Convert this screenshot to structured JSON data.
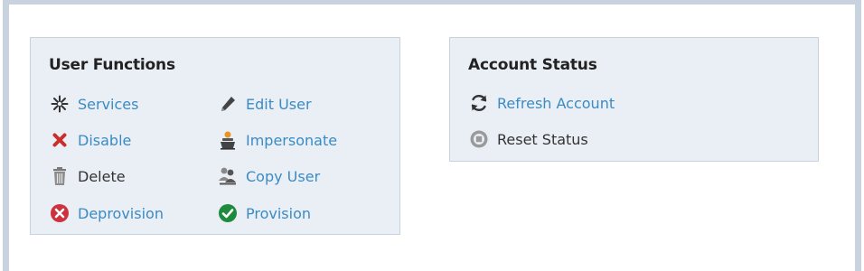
{
  "user_functions": {
    "title": "User Functions",
    "items": [
      {
        "label": "Services",
        "icon": "asterisk-icon",
        "link": true
      },
      {
        "label": "Edit User",
        "icon": "pencil-icon",
        "link": true
      },
      {
        "label": "Disable",
        "icon": "red-x-icon",
        "link": true
      },
      {
        "label": "Impersonate",
        "icon": "impersonate-icon",
        "link": true
      },
      {
        "label": "Delete",
        "icon": "trash-icon",
        "link": false
      },
      {
        "label": "Copy User",
        "icon": "copy-user-icon",
        "link": true
      },
      {
        "label": "Deprovision",
        "icon": "red-circle-x-icon",
        "link": true
      },
      {
        "label": "Provision",
        "icon": "green-check-circle-icon",
        "link": true
      }
    ]
  },
  "account_status": {
    "title": "Account Status",
    "items": [
      {
        "label": "Refresh Account",
        "icon": "refresh-icon",
        "link": true
      },
      {
        "label": "Reset Status",
        "icon": "stop-circle-icon",
        "link": false
      }
    ]
  },
  "colors": {
    "link": "#3b8bc3",
    "panel_bg": "#eaeff6",
    "panel_border": "#c8d2df",
    "danger": "#c9302c",
    "success": "#1e8a3e"
  }
}
